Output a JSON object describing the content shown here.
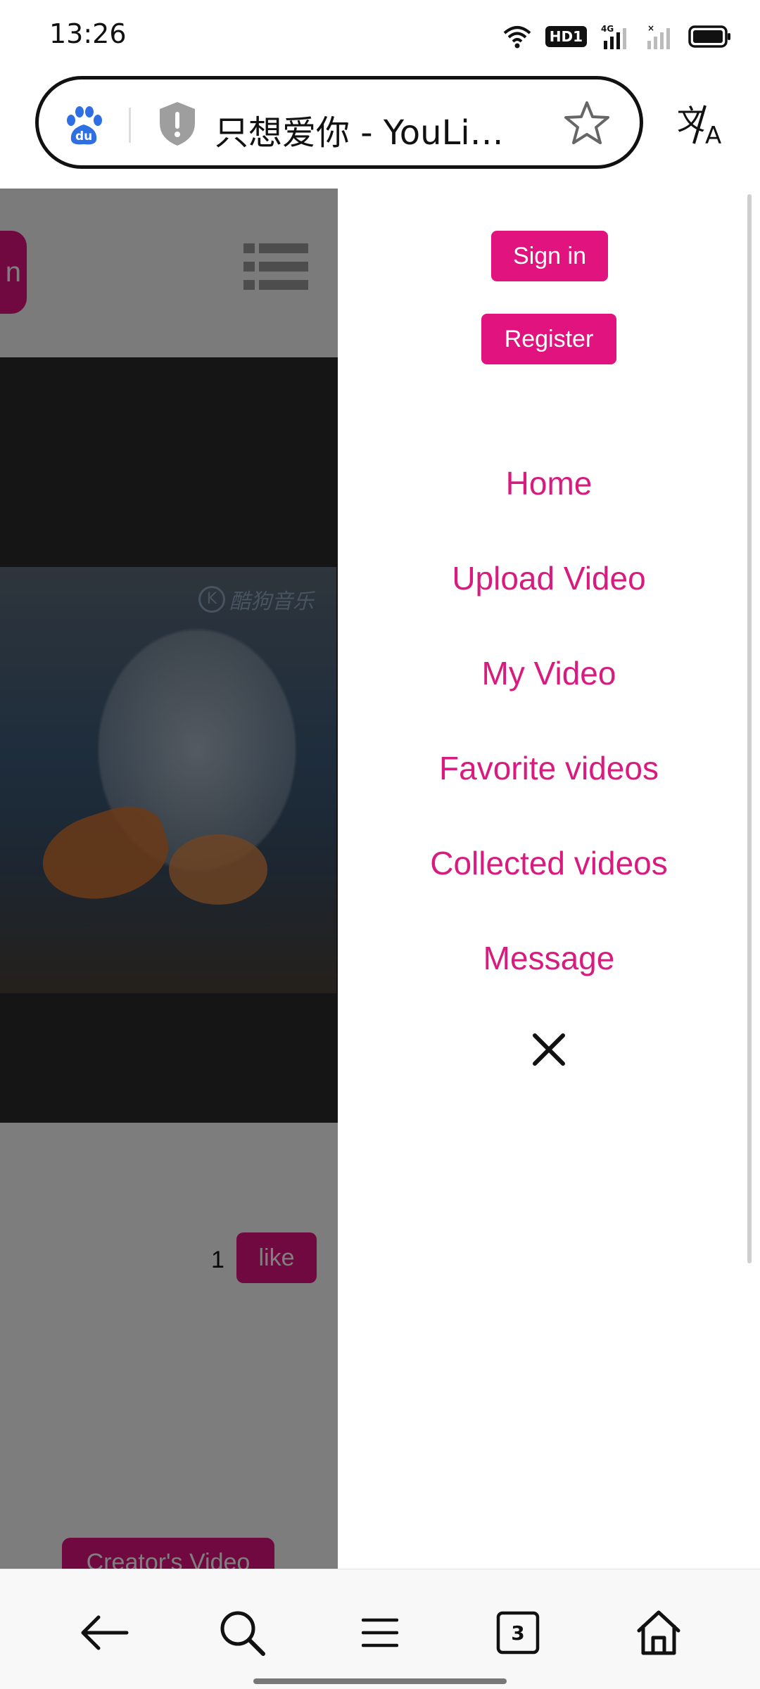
{
  "status_bar": {
    "time": "13:26",
    "network_badge": "HD1",
    "network_type": "4G",
    "icons": [
      "wifi-icon",
      "hd-badge",
      "signal-4g-icon",
      "signal-empty-icon",
      "battery-icon"
    ]
  },
  "browser": {
    "tab_title": "只想爱你 - YouLink ...",
    "open_tab_count": "3",
    "icons": [
      "baidu-icon",
      "shield-icon",
      "star-icon",
      "translate-icon"
    ]
  },
  "page": {
    "partial_button_text": "n",
    "watermark": "酷狗音乐",
    "watermark_logo": "K",
    "like_count": "1",
    "like_label": "like",
    "creator_video_label": "Creator's Video"
  },
  "drawer": {
    "sign_in_label": "Sign in",
    "register_label": "Register",
    "menu": [
      {
        "label": "Home"
      },
      {
        "label": "Upload Video"
      },
      {
        "label": "My Video"
      },
      {
        "label": "Favorite videos"
      },
      {
        "label": "Collected videos"
      },
      {
        "label": "Message"
      }
    ]
  },
  "colors": {
    "accent": "#e0137f",
    "menu_text": "#d81b7f",
    "overlay": "rgba(0,0,0,0.5)"
  }
}
